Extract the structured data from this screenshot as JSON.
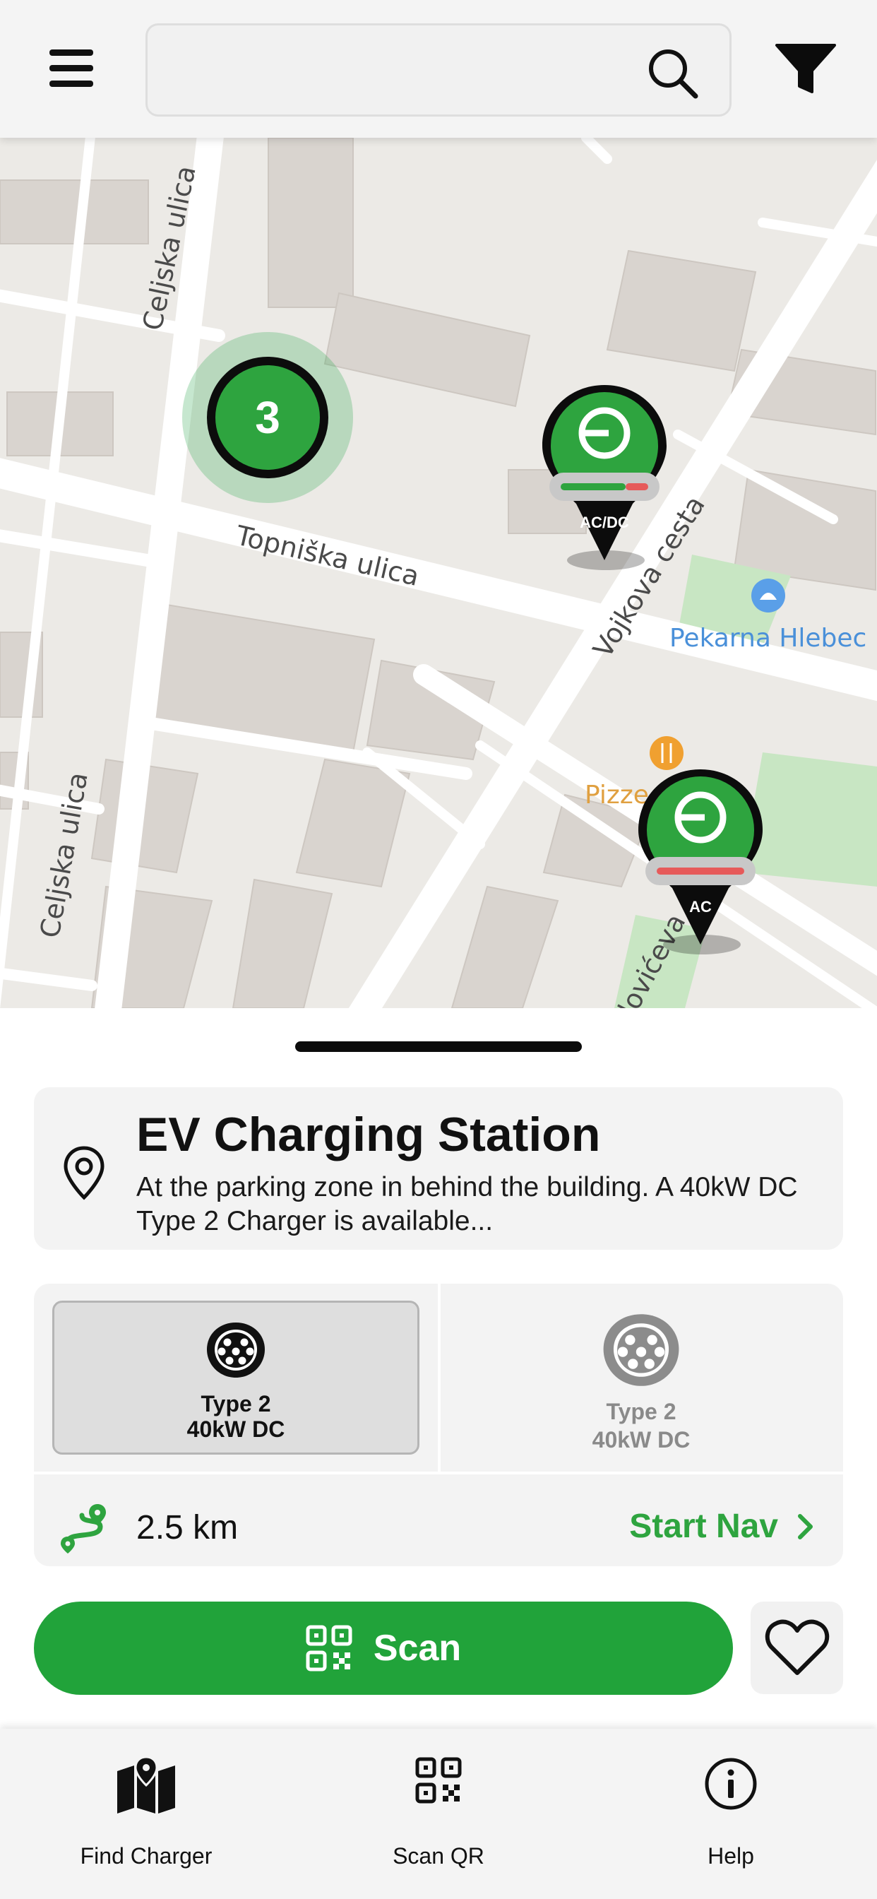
{
  "search": {
    "placeholder": "",
    "value": ""
  },
  "map": {
    "streets": [
      "Celjska ulica",
      "Topniška ulica",
      "Vojkova cesta",
      "Celjska ulica",
      "dovićeva c"
    ],
    "pois": [
      "Pekarna Hlebec",
      "Pizze"
    ],
    "cluster_count": "3",
    "markers": [
      {
        "label": "AC/DC"
      },
      {
        "label": "AC"
      }
    ]
  },
  "station": {
    "title": "EV Charging Station",
    "description": "At the parking zone in behind the building. A 40kW DC Type 2 Charger is available..."
  },
  "connectors": [
    {
      "name": "Type 2",
      "power": "40kW DC",
      "selected": true
    },
    {
      "name": "Type 2",
      "power": "40kW DC",
      "selected": false
    }
  ],
  "route": {
    "distance": "2.5 km",
    "start_nav_label": "Start Nav"
  },
  "actions": {
    "scan_label": "Scan"
  },
  "bottom_nav": [
    {
      "label": "Find Charger",
      "icon": "map-icon"
    },
    {
      "label": "Scan QR",
      "icon": "qr-icon"
    },
    {
      "label": "Help",
      "icon": "info-icon"
    }
  ],
  "colors": {
    "brand_green": "#21a33a",
    "accent_red": "#e65a5a"
  }
}
